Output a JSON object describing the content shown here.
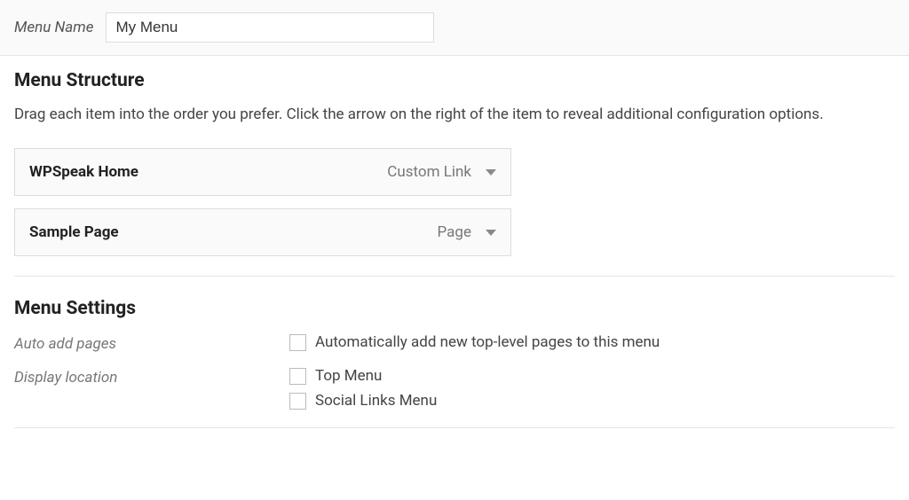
{
  "menuNameBar": {
    "label": "Menu Name",
    "value": "My Menu"
  },
  "structure": {
    "heading": "Menu Structure",
    "instructions": "Drag each item into the order you prefer. Click the arrow on the right of the item to reveal additional configuration options.",
    "items": [
      {
        "title": "WPSpeak Home",
        "type": "Custom Link"
      },
      {
        "title": "Sample Page",
        "type": "Page"
      }
    ]
  },
  "settings": {
    "heading": "Menu Settings",
    "autoAdd": {
      "label": "Auto add pages",
      "checkbox": "Automatically add new top-level pages to this menu"
    },
    "displayLocation": {
      "label": "Display location",
      "options": [
        "Top Menu",
        "Social Links Menu"
      ]
    }
  }
}
